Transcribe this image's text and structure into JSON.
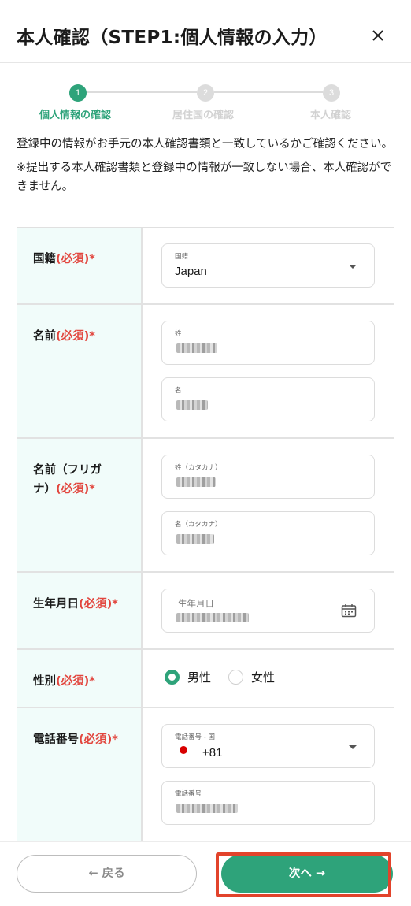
{
  "header": {
    "title": "本人確認（STEP1:個人情報の入力）"
  },
  "stepper": {
    "steps": [
      {
        "number": "1",
        "label": "個人情報の確認"
      },
      {
        "number": "2",
        "label": "居住国の確認"
      },
      {
        "number": "3",
        "label": "本人確認"
      }
    ],
    "active_index": 0
  },
  "intro": {
    "line1": "登録中の情報がお手元の本人確認書類と一致しているかご確認ください。",
    "line2": "※提出する本人確認書類と登録中の情報が一致しない場合、本人確認ができません。"
  },
  "form": {
    "nationality": {
      "label": "国籍",
      "required": "(必須)*",
      "caption": "国籍",
      "value": "Japan"
    },
    "name": {
      "label": "名前",
      "required": "(必須)*",
      "last_caption": "姓",
      "first_caption": "名"
    },
    "name_kana": {
      "label_line1": "名前（フリガ",
      "label_line2": "ナ）",
      "required": "(必須)*",
      "last_caption": "姓（カタカナ）",
      "first_caption": "名（カタカナ）"
    },
    "birthdate": {
      "label": "生年月日",
      "required": "(必須)*",
      "caption": "生年月日"
    },
    "gender": {
      "label": "性別",
      "required": "(必須)*",
      "options": [
        "男性",
        "女性"
      ],
      "selected": "男性"
    },
    "phone": {
      "label": "電話番号",
      "required": "(必須)*",
      "country_caption": "電話番号 - 国",
      "dial_code": "+81",
      "number_caption": "電話番号"
    }
  },
  "footer": {
    "back_label": "← 戻る",
    "next_label": "次へ →"
  },
  "colors": {
    "accent": "#2ea37a",
    "required": "#e2463e",
    "label_bg": "#f1fcfa",
    "highlight": "#e2432b"
  }
}
